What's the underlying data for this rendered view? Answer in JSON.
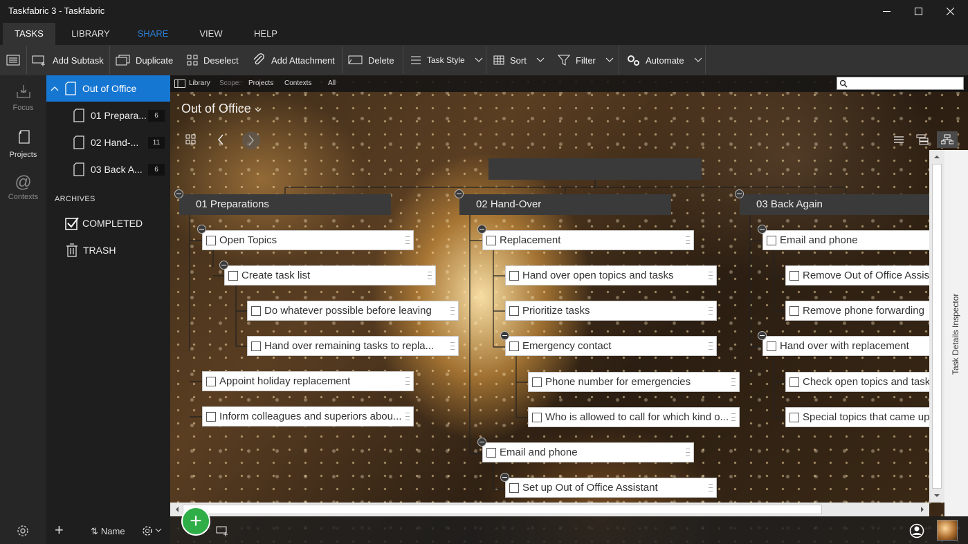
{
  "window": {
    "title": "Taskfabric 3 - Taskfabric"
  },
  "menu": {
    "tabs": [
      "TASKS",
      "LIBRARY",
      "SHARE",
      "VIEW",
      "HELP"
    ]
  },
  "toolbar": {
    "add_subtask": "Add Subtask",
    "duplicate": "Duplicate",
    "deselect": "Deselect",
    "add_attachment": "Add Attachment",
    "delete": "Delete",
    "task_style": "Task Style",
    "sort": "Sort",
    "filter": "Filter",
    "automate": "Automate"
  },
  "rail": {
    "focus": "Focus",
    "projects": "Projects",
    "contexts": "Contexts"
  },
  "sidebar": {
    "project": "Out of Office",
    "items": [
      {
        "label": "01 Prepara...",
        "count": "6"
      },
      {
        "label": "02 Hand-...",
        "count": "11"
      },
      {
        "label": "03 Back A...",
        "count": "6"
      }
    ],
    "archives_label": "ARCHIVES",
    "completed": "COMPLETED",
    "trash": "TRASH",
    "sort_label": "Name"
  },
  "strip": {
    "library": "Library",
    "scope": "Scope:",
    "projects": "Projects",
    "contexts": "Contexts",
    "all": "All"
  },
  "project_title": "Out of Office",
  "groups": [
    {
      "title": "01 Preparations",
      "tasks": [
        "Open Topics",
        "Create task list",
        "Do whatever possible before leaving",
        "Hand over remaining tasks to repla...",
        "Appoint holiday replacement",
        "Inform colleagues and superiors abou..."
      ]
    },
    {
      "title": "02 Hand-Over",
      "tasks": [
        "Replacement",
        "Hand over open topics and tasks",
        "Prioritize tasks",
        "Emergency contact",
        "Phone number for emergencies",
        "Who is allowed to call for which kind o...",
        "Email and phone",
        "Set up Out of Office Assistant"
      ]
    },
    {
      "title": "03 Back Again",
      "tasks": [
        "Email and phone",
        "Remove Out of Office Assis",
        "Remove phone forwarding",
        "Hand over with replacement",
        "Check open topics and task",
        "Special topics that came up"
      ]
    }
  ],
  "inspector": {
    "label": "Task Details Inspector"
  },
  "colors": {
    "accent": "#1677d2",
    "fab": "#2fae48",
    "share": "#2a7fd4"
  }
}
